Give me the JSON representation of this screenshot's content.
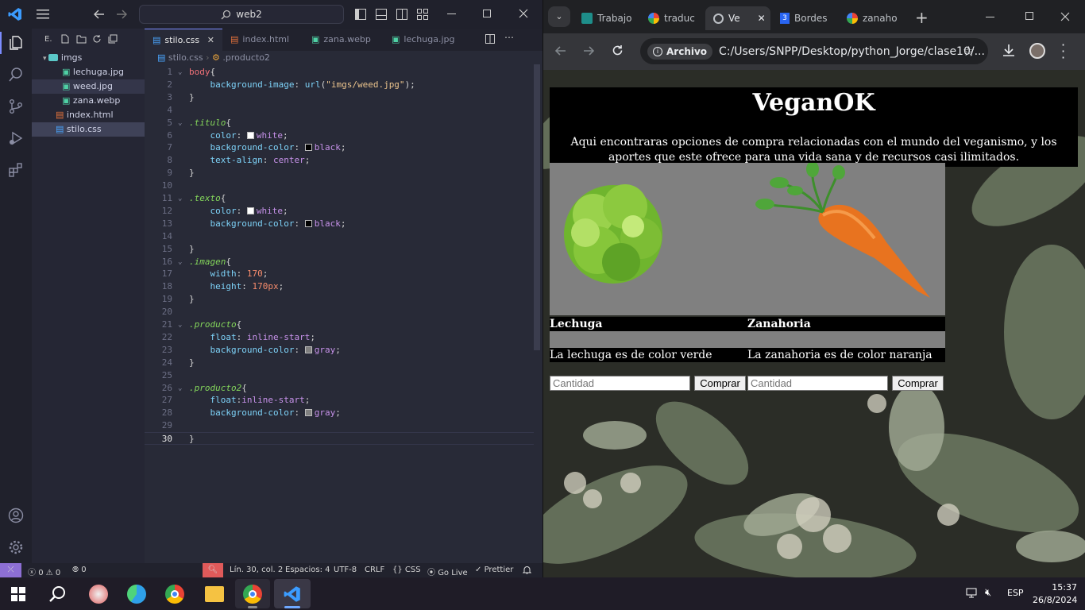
{
  "vscode": {
    "search_box": "web2",
    "explorer": {
      "header": "E.",
      "folder": "imgs",
      "files": [
        "lechuga.jpg",
        "weed.jpg",
        "zana.webp"
      ],
      "root_files": [
        "index.html",
        "stilo.css"
      ]
    },
    "tabs": [
      "stilo.css",
      "index.html",
      "zana.webp",
      "lechuga.jpg"
    ],
    "breadcrumb": {
      "file": "stilo.css",
      "symbol": ".producto2"
    },
    "code_lines": [
      {
        "n": "1",
        "fold": true,
        "html": "<span class='tag'>body</span><span class='br'>{</span>"
      },
      {
        "n": "2",
        "fold": false,
        "html": "    <span class='prop'>background-image</span><span class='br'>: </span><span class='prop'>url</span><span class='br'>(</span><span class='str'>\"imgs/weed.jpg\"</span><span class='br'>);</span>"
      },
      {
        "n": "3",
        "fold": false,
        "html": "<span class='br'>}</span>"
      },
      {
        "n": "4",
        "fold": false,
        "html": ""
      },
      {
        "n": "5",
        "fold": true,
        "html": "<span class='sel'>.titulo</span><span class='br'>{</span>"
      },
      {
        "n": "6",
        "fold": false,
        "html": "    <span class='prop'>color</span><span class='br'>: </span><span class='sw' style='background:#fff'></span><span class='val'>white</span><span class='br'>;</span>"
      },
      {
        "n": "7",
        "fold": false,
        "html": "    <span class='prop'>background-color</span><span class='br'>: </span><span class='sw' style='background:#000'></span><span class='val'>black</span><span class='br'>;</span>"
      },
      {
        "n": "8",
        "fold": false,
        "html": "    <span class='prop'>text-align</span><span class='br'>: </span><span class='val'>center</span><span class='br'>;</span>"
      },
      {
        "n": "9",
        "fold": false,
        "html": "<span class='br'>}</span>"
      },
      {
        "n": "10",
        "fold": false,
        "html": ""
      },
      {
        "n": "11",
        "fold": true,
        "html": "<span class='sel'>.texto</span><span class='br'>{</span>"
      },
      {
        "n": "12",
        "fold": false,
        "html": "    <span class='prop'>color</span><span class='br'>: </span><span class='sw' style='background:#fff'></span><span class='val'>white</span><span class='br'>;</span>"
      },
      {
        "n": "13",
        "fold": false,
        "html": "    <span class='prop'>background-color</span><span class='br'>: </span><span class='sw' style='background:#000'></span><span class='val'>black</span><span class='br'>;</span>"
      },
      {
        "n": "14",
        "fold": false,
        "html": ""
      },
      {
        "n": "15",
        "fold": false,
        "html": "<span class='br'>}</span>"
      },
      {
        "n": "16",
        "fold": true,
        "html": "<span class='sel'>.imagen</span><span class='br'>{</span>"
      },
      {
        "n": "17",
        "fold": false,
        "html": "    <span class='prop'>width</span><span class='br'>: </span><span class='num'>170</span><span class='br'>;</span>"
      },
      {
        "n": "18",
        "fold": false,
        "html": "    <span class='prop'>height</span><span class='br'>: </span><span class='num'>170px</span><span class='br'>;</span>"
      },
      {
        "n": "19",
        "fold": false,
        "html": "<span class='br'>}</span>"
      },
      {
        "n": "20",
        "fold": false,
        "html": ""
      },
      {
        "n": "21",
        "fold": true,
        "html": "<span class='sel'>.producto</span><span class='br'>{</span>"
      },
      {
        "n": "22",
        "fold": false,
        "html": "    <span class='prop'>float</span><span class='br'>: </span><span class='val'>inline-start</span><span class='br'>;</span>"
      },
      {
        "n": "23",
        "fold": false,
        "html": "    <span class='prop'>background-color</span><span class='br'>: </span><span class='sw' style='background:#808080'></span><span class='val'>gray</span><span class='br'>;</span>"
      },
      {
        "n": "24",
        "fold": false,
        "html": "<span class='br'>}</span>"
      },
      {
        "n": "25",
        "fold": false,
        "html": ""
      },
      {
        "n": "26",
        "fold": true,
        "html": "<span class='sel'>.producto2</span><span class='br'>{</span>"
      },
      {
        "n": "27",
        "fold": false,
        "html": "    <span class='prop'>float</span><span class='br'>:</span><span class='val'>inline-start</span><span class='br'>;</span>"
      },
      {
        "n": "28",
        "fold": false,
        "html": "    <span class='prop'>background-color</span><span class='br'>: </span><span class='sw' style='background:#808080'></span><span class='val'>gray</span><span class='br'>;</span>"
      },
      {
        "n": "29",
        "fold": false,
        "html": ""
      },
      {
        "n": "30",
        "fold": false,
        "html": "<span class='br'>}</span>"
      }
    ],
    "status": {
      "errors": "0",
      "warnings": "0",
      "ports": "0",
      "position": "Lín. 30, col. 2",
      "spaces": "Espacios: 4",
      "encoding": "UTF-8",
      "eol": "CRLF",
      "language": "CSS",
      "golive": "Go Live",
      "prettier": "Prettier"
    }
  },
  "chrome": {
    "tabs": [
      "Trabajo",
      "traduc",
      "Ve",
      "Bordes",
      "zanaho"
    ],
    "address_label": "Archivo",
    "address": "C:/Users/SNPP/Desktop/python_Jorge/clase10/...",
    "page": {
      "title": "VeganOK",
      "description": "Aqui encontraras opciones de compra relacionadas con el mundo del veganismo, y los aportes que este ofrece para una vida sana y de recursos casi ilimitados.",
      "products": [
        {
          "name": "Lechuga",
          "desc": "La lechuga es de color verde",
          "placeholder": "Cantidad",
          "button": "Comprar"
        },
        {
          "name": "Zanahoria",
          "desc": "La zanahoria es de color naranja",
          "placeholder": "Cantidad",
          "button": "Comprar"
        }
      ]
    }
  },
  "taskbar": {
    "lang": "ESP",
    "time": "15:37",
    "date": "26/8/2024"
  },
  "colors": {
    "accent": "#7c8cff",
    "vscode_bg": "#282a37",
    "chrome_bg": "#202124"
  }
}
